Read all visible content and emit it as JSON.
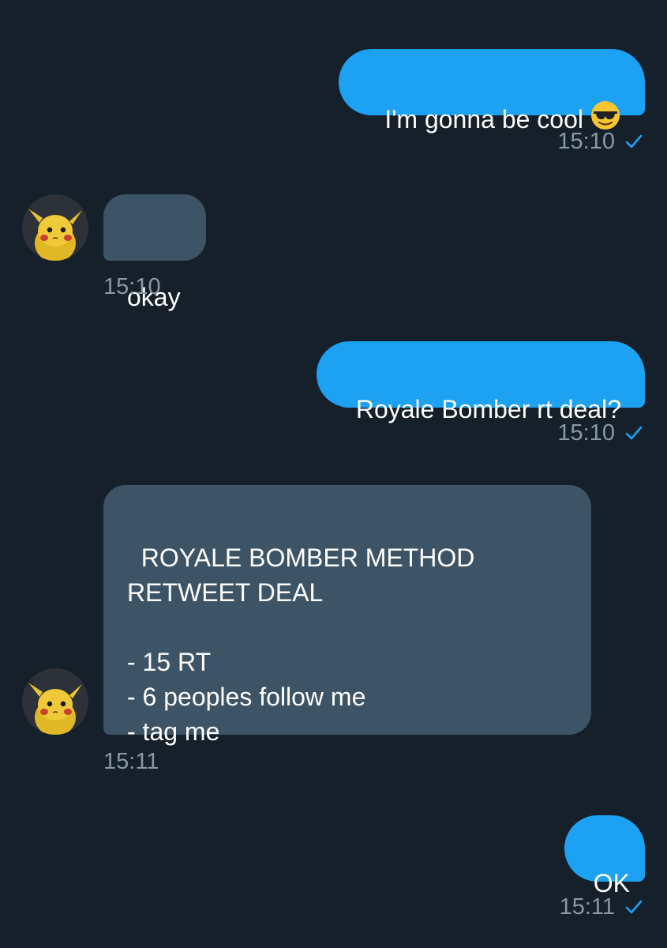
{
  "messages": [
    {
      "direction": "sent",
      "text": "I'm gonna be cool",
      "emoji": "sunglasses-face-emoji",
      "time": "15:10",
      "status": "read-check"
    },
    {
      "direction": "received",
      "text": "okay",
      "time": "15:10",
      "avatar": "pikachu-avatar"
    },
    {
      "direction": "sent",
      "text": "Royale Bomber rt deal?",
      "time": "15:10",
      "status": "read-check"
    },
    {
      "direction": "received",
      "text": "ROYALE BOMBER METHOD\nRETWEET DEAL\n\n- 15 RT\n- 6 peoples follow me\n- tag me",
      "time": "15:11",
      "avatar": "pikachu-avatar"
    },
    {
      "direction": "sent",
      "text": "OK",
      "time": "15:11",
      "status": "read-check"
    }
  ],
  "colors": {
    "background": "#15202b",
    "sent_bubble": "#1da1f2",
    "received_bubble": "#3d5466",
    "timestamp": "#8899a6",
    "check": "#1da1f2"
  }
}
